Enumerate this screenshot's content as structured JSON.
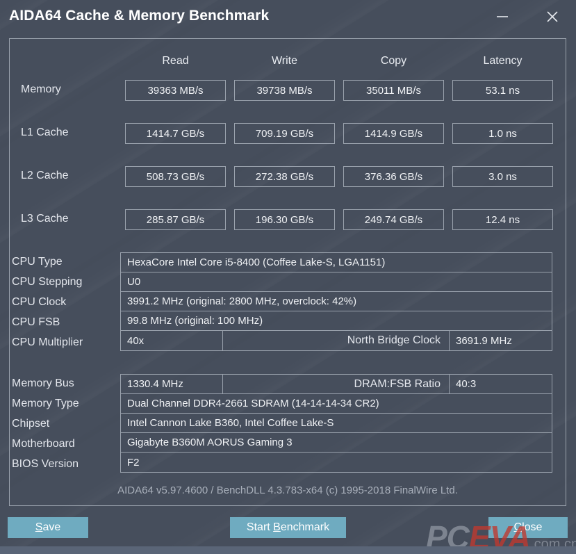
{
  "window": {
    "title": "AIDA64 Cache & Memory Benchmark",
    "minimize_icon": "minimize-icon",
    "close_icon": "close-icon"
  },
  "benchmark": {
    "columns": [
      "Read",
      "Write",
      "Copy",
      "Latency"
    ],
    "rows": [
      {
        "label": "Memory",
        "read": "39363 MB/s",
        "write": "39738 MB/s",
        "copy": "35011 MB/s",
        "latency": "53.1 ns"
      },
      {
        "label": "L1 Cache",
        "read": "1414.7 GB/s",
        "write": "709.19 GB/s",
        "copy": "1414.9 GB/s",
        "latency": "1.0 ns"
      },
      {
        "label": "L2 Cache",
        "read": "508.73 GB/s",
        "write": "272.38 GB/s",
        "copy": "376.36 GB/s",
        "latency": "3.0 ns"
      },
      {
        "label": "L3 Cache",
        "read": "285.87 GB/s",
        "write": "196.30 GB/s",
        "copy": "249.74 GB/s",
        "latency": "12.4 ns"
      }
    ]
  },
  "cpu_info": {
    "type_label": "CPU Type",
    "type_value": "HexaCore Intel Core i5-8400  (Coffee Lake-S, LGA1151)",
    "stepping_label": "CPU Stepping",
    "stepping_value": "U0",
    "clock_label": "CPU Clock",
    "clock_value": "3991.2 MHz  (original: 2800 MHz, overclock: 42%)",
    "fsb_label": "CPU FSB",
    "fsb_value": "99.8 MHz  (original: 100 MHz)",
    "multiplier_label": "CPU Multiplier",
    "multiplier_value": "40x",
    "nb_clock_label": "North Bridge Clock",
    "nb_clock_value": "3691.9 MHz"
  },
  "memory_info": {
    "bus_label": "Memory Bus",
    "bus_value": "1330.4 MHz",
    "ratio_label": "DRAM:FSB Ratio",
    "ratio_value": "40:3",
    "type_label": "Memory Type",
    "type_value": "Dual Channel DDR4-2661 SDRAM  (14-14-14-34 CR2)",
    "chipset_label": "Chipset",
    "chipset_value": "Intel Cannon Lake B360, Intel Coffee Lake-S",
    "motherboard_label": "Motherboard",
    "motherboard_value": "Gigabyte B360M AORUS Gaming 3",
    "bios_label": "BIOS Version",
    "bios_value": "F2"
  },
  "footer": {
    "version_text": "AIDA64 v5.97.4600 / BenchDLL 4.3.783-x64  (c) 1995-2018 FinalWire Ltd.",
    "save_pre": "",
    "save_key": "S",
    "save_post": "ave",
    "start_pre": "Start ",
    "start_key": "B",
    "start_post": "enchmark",
    "close_pre": "",
    "close_key": "C",
    "close_post": "lose"
  },
  "watermark": {
    "part1": "PC",
    "part2": "EVA",
    "part3": ".com.cn"
  },
  "colors": {
    "background": "#464e5c",
    "button": "#6fabc0",
    "border": "#9aa2ad",
    "text": "#e7eaef",
    "muted_text": "#a9b0bb",
    "watermark_red": "#c0392f",
    "bottom_strip": "#5a6577"
  }
}
